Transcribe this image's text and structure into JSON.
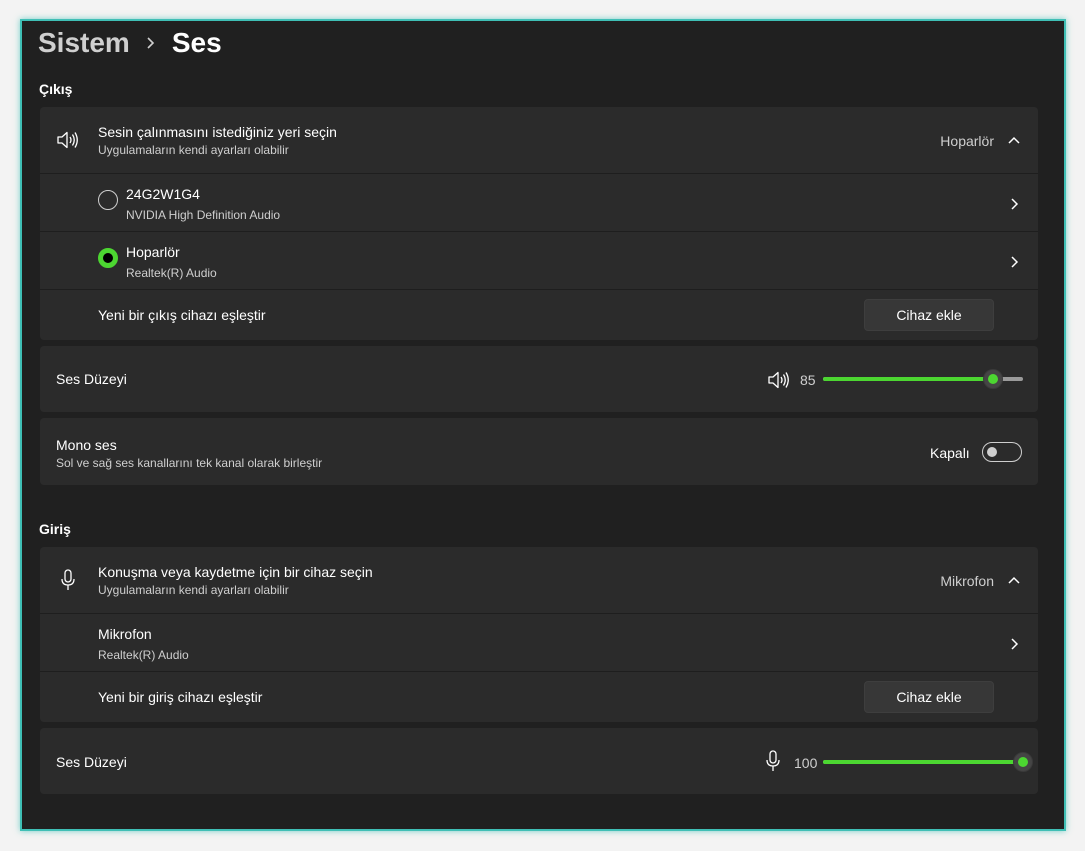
{
  "breadcrumb": {
    "parent": "Sistem",
    "current": "Ses"
  },
  "output": {
    "section_title": "Çıkış",
    "chooser": {
      "title": "Sesin çalınmasını istediğiniz yeri seçin",
      "subtitle": "Uygulamaların kendi ayarları olabilir",
      "selected": "Hoparlör",
      "expanded": true
    },
    "devices": [
      {
        "name": "24G2W1G4",
        "driver": "NVIDIA High Definition Audio",
        "selected": false
      },
      {
        "name": "Hoparlör",
        "driver": "Realtek(R) Audio",
        "selected": true
      }
    ],
    "pair": {
      "label": "Yeni bir çıkış cihazı eşleştir",
      "button": "Cihaz ekle"
    },
    "volume": {
      "label": "Ses Düzeyi",
      "value": "85",
      "fraction": 0.85
    },
    "mono": {
      "title": "Mono ses",
      "subtitle": "Sol ve sağ ses kanallarını tek kanal olarak birleştir",
      "state": "Kapalı",
      "on": false
    }
  },
  "input": {
    "section_title": "Giriş",
    "chooser": {
      "title": "Konuşma veya kaydetme için bir cihaz seçin",
      "subtitle": "Uygulamaların kendi ayarları olabilir",
      "selected": "Mikrofon",
      "expanded": true
    },
    "devices": [
      {
        "name": "Mikrofon",
        "driver": "Realtek(R) Audio"
      }
    ],
    "pair": {
      "label": "Yeni bir giriş cihazı eşleştir",
      "button": "Cihaz ekle"
    },
    "volume": {
      "label": "Ses Düzeyi",
      "value": "100",
      "fraction": 1.0
    }
  },
  "colors": {
    "accent": "#4cd631",
    "window_bg": "#202020",
    "card_bg": "#2b2b2b",
    "window_border": "#3fbfb5"
  },
  "icons": {
    "speaker": "speaker-icon",
    "microphone": "microphone-icon",
    "chevron_right": "chevron-right-icon",
    "chevron_up": "chevron-up-icon"
  }
}
